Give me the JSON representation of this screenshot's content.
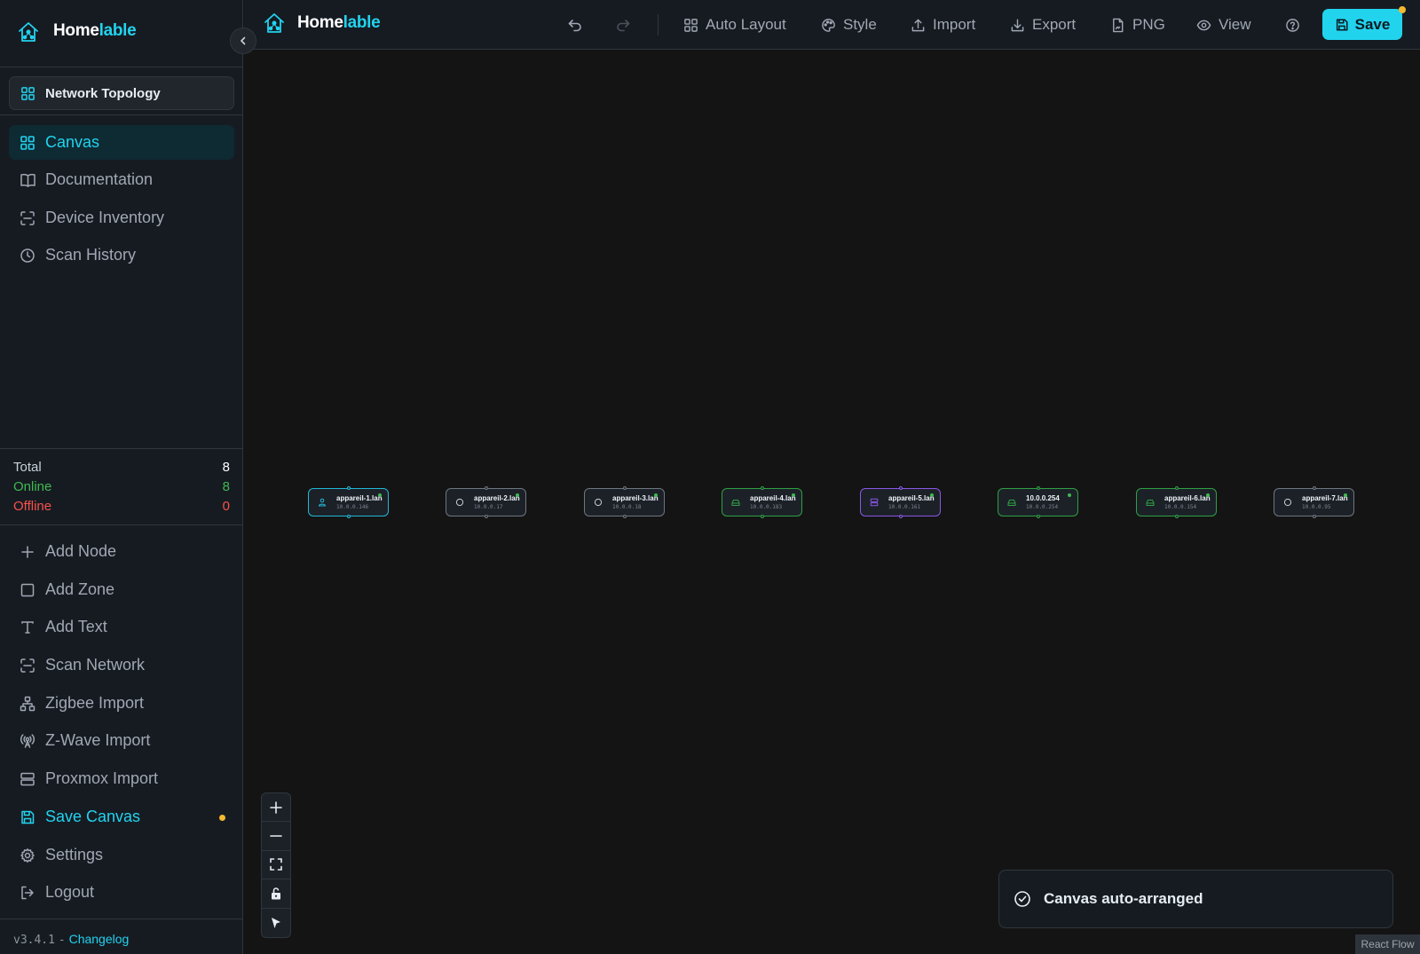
{
  "brand": {
    "part1": "Home",
    "part2": "lable"
  },
  "topology": {
    "label": "Network Topology"
  },
  "nav": {
    "canvas": "Canvas",
    "documentation": "Documentation",
    "device_inventory": "Device Inventory",
    "scan_history": "Scan History"
  },
  "stats": {
    "total_label": "Total",
    "total_value": "8",
    "online_label": "Online",
    "online_value": "8",
    "offline_label": "Offline",
    "offline_value": "0"
  },
  "actions": {
    "add_node": "Add Node",
    "add_zone": "Add Zone",
    "add_text": "Add Text",
    "scan_network": "Scan Network",
    "zigbee_import": "Zigbee Import",
    "zwave_import": "Z-Wave Import",
    "proxmox_import": "Proxmox Import",
    "save_canvas": "Save Canvas",
    "settings": "Settings",
    "logout": "Logout"
  },
  "footer": {
    "version": "v3.4.1",
    "separator": "-",
    "changelog": "Changelog"
  },
  "toolbar": {
    "auto_layout": "Auto Layout",
    "style": "Style",
    "import": "Import",
    "export": "Export",
    "png": "PNG",
    "view": "View",
    "save": "Save"
  },
  "nodes": [
    {
      "name": "appareil-1.lan",
      "ip": "10.0.0.146",
      "icon": "user-icon",
      "status": "online",
      "accent": "#22b8d6"
    },
    {
      "name": "appareil-2.lan",
      "ip": "10.0.0.17",
      "icon": "circle-icon",
      "status": "online",
      "accent": "#6e7681"
    },
    {
      "name": "appareil-3.lan",
      "ip": "10.0.0.18",
      "icon": "circle-icon",
      "status": "online",
      "accent": "#6e7681"
    },
    {
      "name": "appareil-4.lan",
      "ip": "10.0.0.183",
      "icon": "harddrive-icon",
      "status": "online",
      "accent": "#2ea043"
    },
    {
      "name": "appareil-5.lan",
      "ip": "10.0.0.161",
      "icon": "server-icon",
      "status": "online",
      "accent": "#8957e5"
    },
    {
      "name": "10.0.0.254",
      "ip": "10.0.0.254",
      "icon": "harddrive-icon",
      "status": "online",
      "accent": "#2ea043"
    },
    {
      "name": "appareil-6.lan",
      "ip": "10.0.0.154",
      "icon": "harddrive-icon",
      "status": "online",
      "accent": "#2ea043"
    },
    {
      "name": "appareil-7.lan",
      "ip": "10.0.0.95",
      "icon": "circle-icon",
      "status": "online",
      "accent": "#6e7681"
    }
  ],
  "toast": {
    "message": "Canvas auto-arranged"
  },
  "attribution": "React Flow",
  "colors": {
    "accent": "#22d3ee",
    "online": "#3fb950",
    "offline": "#f85149",
    "unsaved": "#f5b930"
  }
}
